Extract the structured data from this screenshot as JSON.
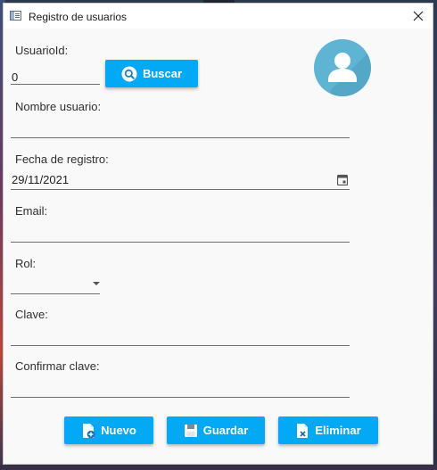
{
  "window": {
    "title": "Registro de usuarios"
  },
  "form": {
    "usuario_id": {
      "label": "UsuarioId:",
      "value": "0"
    },
    "buscar_label": "Buscar",
    "nombre_usuario": {
      "label": "Nombre usuario:",
      "value": ""
    },
    "fecha_registro": {
      "label": "Fecha de registro:",
      "value": "29/11/2021"
    },
    "email": {
      "label": "Email:",
      "value": ""
    },
    "rol": {
      "label": "Rol:",
      "selected": ""
    },
    "clave": {
      "label": "Clave:",
      "value": ""
    },
    "confirmar_clave": {
      "label": "Confirmar clave:",
      "value": ""
    }
  },
  "actions": {
    "nuevo": "Nuevo",
    "guardar": "Guardar",
    "eliminar": "Eliminar"
  },
  "icons": {
    "window": "app-window-icon",
    "close": "close-icon",
    "search": "search-icon",
    "calendar": "calendar-icon",
    "avatar": "user-avatar-icon",
    "nuevo": "new-document-icon",
    "guardar": "save-icon",
    "eliminar": "delete-document-icon"
  },
  "colors": {
    "accent": "#03a9f4",
    "avatar_bg": "#5fb4d3",
    "window_bg": "#f9f9f9"
  }
}
